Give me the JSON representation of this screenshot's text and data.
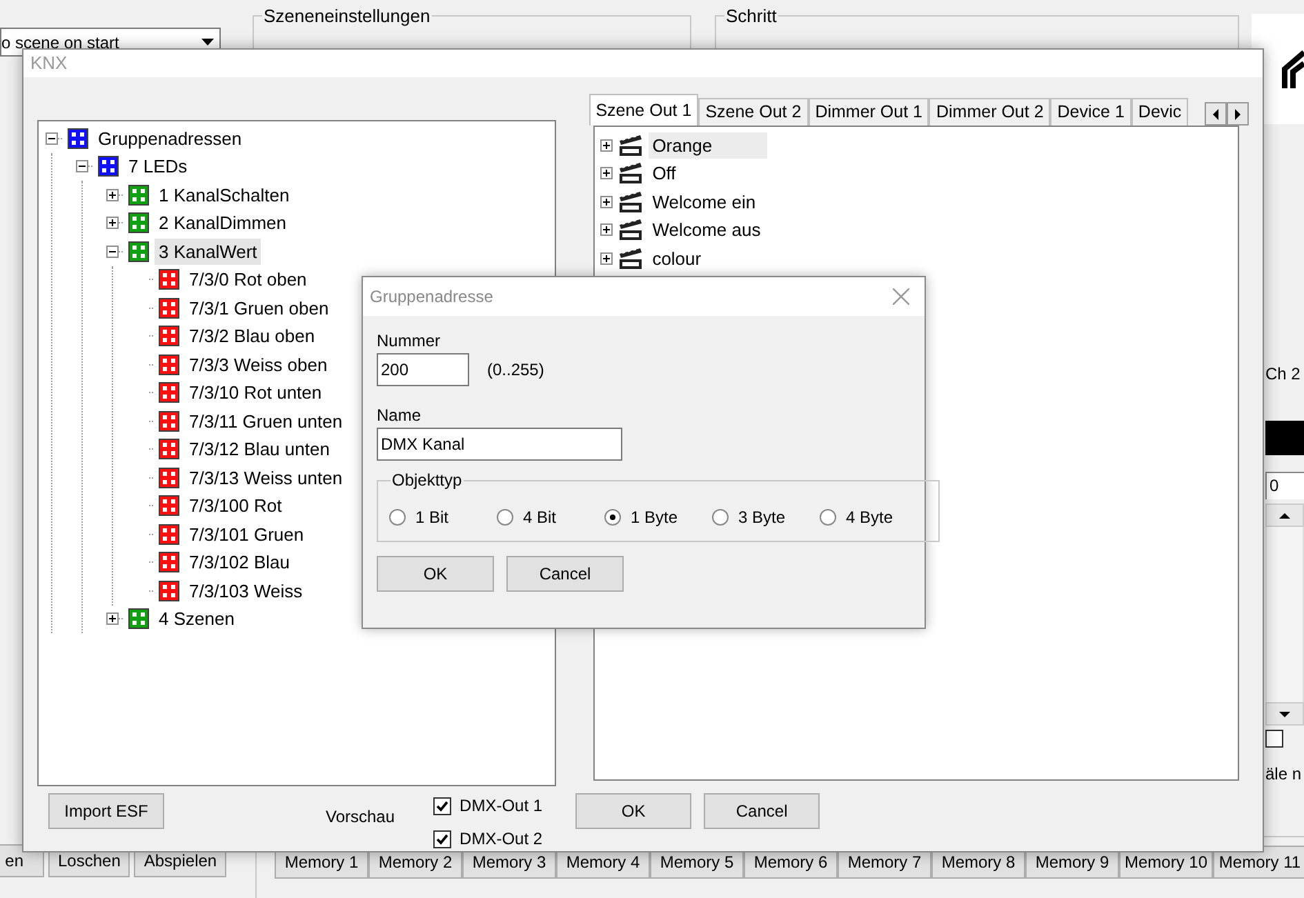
{
  "background_app": {
    "scene_combo": {
      "value": "o scene on start"
    },
    "groups": [
      "Szeneneinstellungen",
      "Schritt"
    ],
    "channel_label": "Ch 2",
    "channel_value": "0",
    "option": {
      "label": "äle n",
      "checked": false
    },
    "buttons": [
      "en",
      "Loschen",
      "Abspielen"
    ],
    "memory_buttons": [
      "Memory 1",
      "Memory 2",
      "Memory 3",
      "Memory 4",
      "Memory 5",
      "Memory 6",
      "Memory 7",
      "Memory 8",
      "Memory 9",
      "Memory 10",
      "Memory 11"
    ]
  },
  "knx_window": {
    "title": "KNX",
    "tree": [
      {
        "label": "Gruppenadressen",
        "color": "#1010ff",
        "expanded": true,
        "selected": false,
        "children": [
          {
            "label": "7 LEDs",
            "color": "#1010ff",
            "expanded": true,
            "selected": false,
            "children": [
              {
                "label": "1 KanalSchalten",
                "color": "#10a010",
                "expanded": false,
                "selected": false
              },
              {
                "label": "2 KanalDimmen",
                "color": "#10a010",
                "expanded": false,
                "selected": false
              },
              {
                "label": "3 KanalWert",
                "color": "#10a010",
                "expanded": true,
                "selected": true,
                "children": [
                  {
                    "label": "7/3/0 Rot oben",
                    "color": "#ff1010",
                    "selected": false
                  },
                  {
                    "label": "7/3/1 Gruen oben",
                    "color": "#ff1010",
                    "selected": false
                  },
                  {
                    "label": "7/3/2 Blau oben",
                    "color": "#ff1010",
                    "selected": false
                  },
                  {
                    "label": "7/3/3 Weiss oben",
                    "color": "#ff1010",
                    "selected": false
                  },
                  {
                    "label": "7/3/10 Rot unten",
                    "color": "#ff1010",
                    "selected": false
                  },
                  {
                    "label": "7/3/11 Gruen unten",
                    "color": "#ff1010",
                    "selected": false
                  },
                  {
                    "label": "7/3/12 Blau unten",
                    "color": "#ff1010",
                    "selected": false
                  },
                  {
                    "label": "7/3/13 Weiss unten",
                    "color": "#ff1010",
                    "selected": false
                  },
                  {
                    "label": "7/3/100 Rot",
                    "color": "#ff1010",
                    "selected": false
                  },
                  {
                    "label": "7/3/101 Gruen",
                    "color": "#ff1010",
                    "selected": false
                  },
                  {
                    "label": "7/3/102 Blau",
                    "color": "#ff1010",
                    "selected": false
                  },
                  {
                    "label": "7/3/103 Weiss",
                    "color": "#ff1010",
                    "selected": false
                  }
                ]
              },
              {
                "label": "4 Szenen",
                "color": "#10a010",
                "expanded": false,
                "selected": false
              }
            ]
          }
        ]
      }
    ],
    "tabs": [
      {
        "label": "Szene Out 1",
        "selected": true
      },
      {
        "label": "Szene Out 2",
        "selected": false
      },
      {
        "label": "Dimmer Out 1",
        "selected": false
      },
      {
        "label": "Dimmer Out 2",
        "selected": false
      },
      {
        "label": "Device 1",
        "selected": false
      },
      {
        "label": "Devic",
        "selected": false
      }
    ],
    "scenes": [
      {
        "label": "Orange",
        "selected": true,
        "expanded": false
      },
      {
        "label": "Off",
        "selected": false,
        "expanded": false
      },
      {
        "label": "Welcome ein",
        "selected": false,
        "expanded": false
      },
      {
        "label": "Welcome aus",
        "selected": false,
        "expanded": false
      },
      {
        "label": "colour",
        "selected": false,
        "expanded": false
      }
    ],
    "import_button": "Import ESF",
    "preview_label": "Vorschau",
    "preview_outputs": [
      {
        "label": "DMX-Out 1",
        "checked": true
      },
      {
        "label": "DMX-Out 2",
        "checked": true
      }
    ],
    "buttons": [
      "OK",
      "Cancel"
    ]
  },
  "group_address_dialog": {
    "title": "Gruppenadresse",
    "number_label": "Nummer",
    "number_value": "200",
    "number_range": "(0..255)",
    "name_label": "Name",
    "name_value": "DMX Kanal",
    "object_type_label": "Objekttyp",
    "object_types": [
      {
        "label": "1 Bit",
        "selected": false
      },
      {
        "label": "4 Bit",
        "selected": false
      },
      {
        "label": "1 Byte",
        "selected": true
      },
      {
        "label": "3 Byte",
        "selected": false
      },
      {
        "label": "4 Byte",
        "selected": false
      }
    ],
    "buttons": [
      "OK",
      "Cancel"
    ]
  }
}
